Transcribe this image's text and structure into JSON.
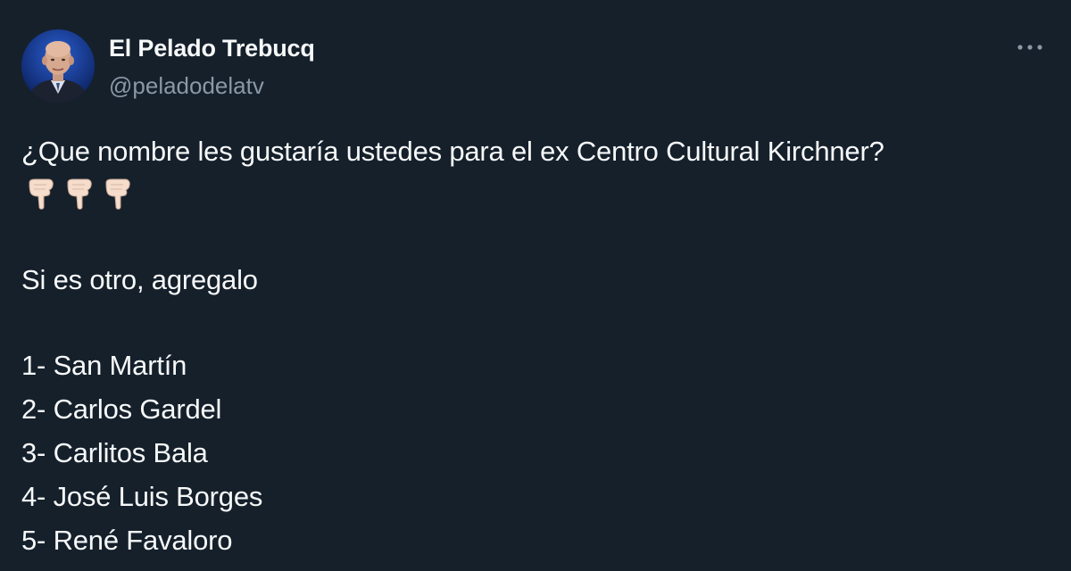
{
  "author": {
    "name": "El Pelado Trebucq",
    "handle": "@peladodelatv"
  },
  "icons": {
    "more": "more-horizontal-icon",
    "emoji": "backhand-index-pointing-down-icon"
  },
  "tweet": {
    "question": "¿Que nombre les gustaría ustedes para el ex Centro Cultural Kirchner?",
    "emoji_count": 3,
    "instruction": "Si es otro, agregalo",
    "options": [
      "1- San Martín",
      "2- Carlos Gardel",
      "3- Carlitos Bala",
      "4- José Luis Borges",
      "5- René Favaloro"
    ]
  },
  "colors": {
    "background": "#15202b",
    "text": "#f7f9f9",
    "secondary": "#8b98a5"
  }
}
